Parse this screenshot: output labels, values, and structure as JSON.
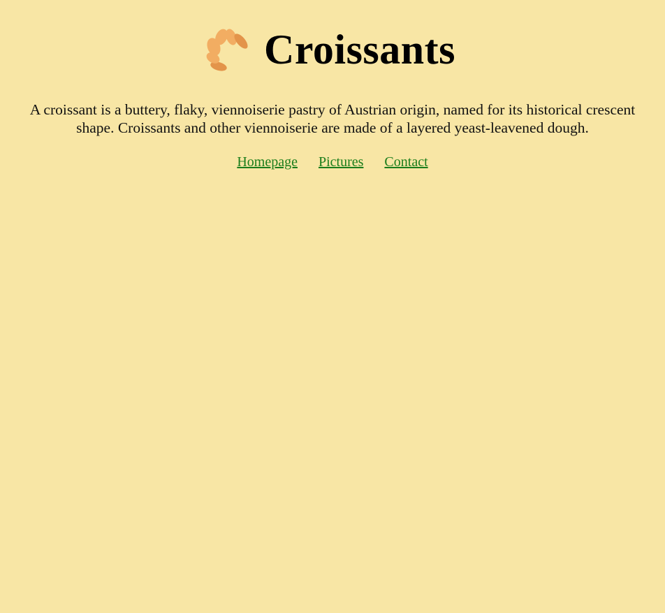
{
  "header": {
    "logo_icon": "croissant-icon",
    "title": "Croissants"
  },
  "intro": {
    "text": "A croissant is a buttery, flaky, viennoiserie pastry of Austrian origin, named for its historical crescent shape. Croissants and other viennoiserie are made of a layered yeast-leavened dough."
  },
  "nav": {
    "links": [
      {
        "label": "Homepage"
      },
      {
        "label": "Pictures"
      },
      {
        "label": "Contact"
      }
    ]
  },
  "colors": {
    "background": "#f8e6a5",
    "link": "#1b7d1b",
    "croissant_light": "#f2ad62",
    "croissant_dark": "#e3944a"
  }
}
